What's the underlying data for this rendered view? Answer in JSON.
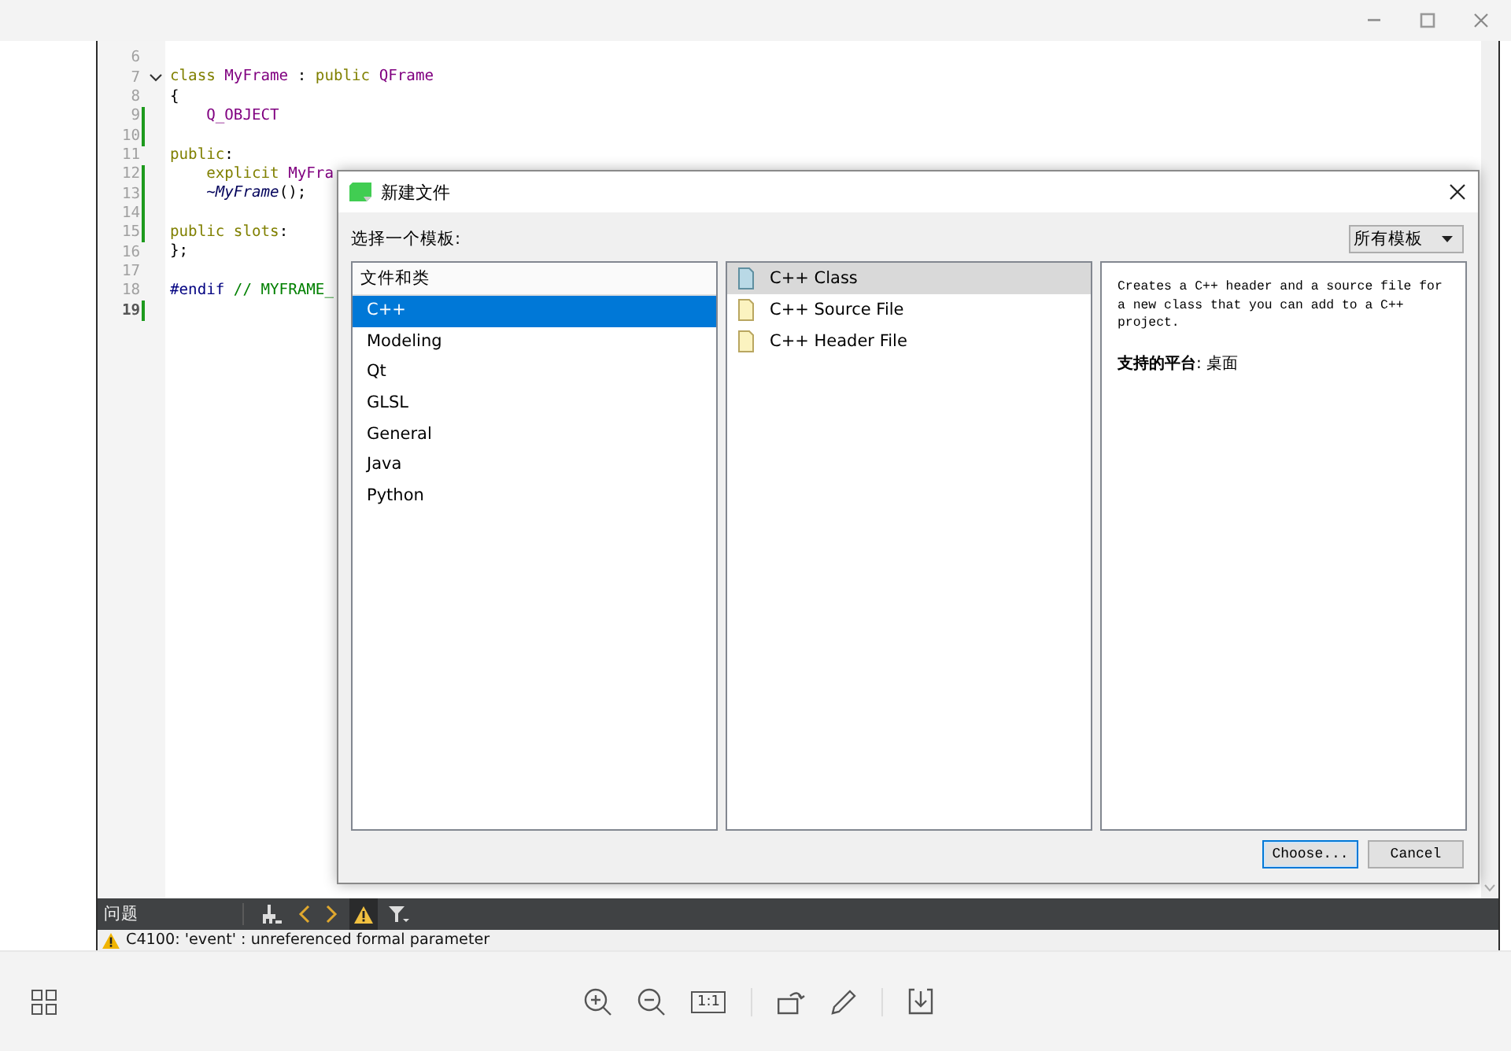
{
  "editor": {
    "lines": [
      {
        "number": "6",
        "changed": false,
        "current": false,
        "fold": false
      },
      {
        "number": "7",
        "changed": false,
        "current": false,
        "fold": true,
        "tokens": [
          {
            "kind": "keyword",
            "text": "class "
          },
          {
            "kind": "type",
            "text": "MyFrame"
          },
          {
            "kind": "plain",
            "text": " : "
          },
          {
            "kind": "keyword",
            "text": "public "
          },
          {
            "kind": "type",
            "text": "QFrame"
          }
        ]
      },
      {
        "number": "8",
        "changed": false,
        "current": false,
        "fold": false,
        "tokens": [
          {
            "kind": "plain",
            "text": "{"
          }
        ]
      },
      {
        "number": "9",
        "changed": true,
        "current": false,
        "fold": false,
        "tokens": [
          {
            "kind": "type",
            "text": "    Q_OBJECT"
          }
        ]
      },
      {
        "number": "10",
        "changed": true,
        "current": false,
        "fold": false
      },
      {
        "number": "11",
        "changed": false,
        "current": false,
        "fold": false,
        "tokens": [
          {
            "kind": "keyword",
            "text": "public"
          },
          {
            "kind": "plain",
            "text": ":"
          }
        ]
      },
      {
        "number": "12",
        "changed": true,
        "current": false,
        "fold": false,
        "tokens": [
          {
            "kind": "keyword",
            "text": "    explicit "
          },
          {
            "kind": "type",
            "text": "MyFra"
          }
        ]
      },
      {
        "number": "13",
        "changed": true,
        "current": false,
        "fold": false,
        "tokens": [
          {
            "kind": "function",
            "text": "    ~MyFrame"
          },
          {
            "kind": "plain",
            "text": "();"
          }
        ]
      },
      {
        "number": "14",
        "changed": true,
        "current": false,
        "fold": false
      },
      {
        "number": "15",
        "changed": true,
        "current": false,
        "fold": false,
        "tokens": [
          {
            "kind": "keyword",
            "text": "public slots"
          },
          {
            "kind": "plain",
            "text": ":"
          }
        ]
      },
      {
        "number": "16",
        "changed": false,
        "current": false,
        "fold": false,
        "tokens": [
          {
            "kind": "plain",
            "text": "};"
          }
        ]
      },
      {
        "number": "17",
        "changed": false,
        "current": false,
        "fold": false
      },
      {
        "number": "18",
        "changed": false,
        "current": false,
        "fold": false,
        "tokens": [
          {
            "kind": "preprocessor",
            "text": "#endif"
          },
          {
            "kind": "comment",
            "text": " // MYFRAME_"
          }
        ]
      },
      {
        "number": "19",
        "changed": true,
        "current": true,
        "fold": false
      }
    ]
  },
  "issues_panel": {
    "title": "问题",
    "warning_filter_on": true,
    "message": "C4100: 'event' : unreferenced formal parameter"
  },
  "dialog": {
    "title": "新建文件",
    "prompt": "选择一个模板:",
    "filter": "所有模板",
    "categories_header": "文件和类",
    "categories": [
      {
        "label": "C++",
        "selected": true
      },
      {
        "label": "Modeling",
        "selected": false
      },
      {
        "label": "Qt",
        "selected": false
      },
      {
        "label": "GLSL",
        "selected": false
      },
      {
        "label": "General",
        "selected": false
      },
      {
        "label": "Java",
        "selected": false
      },
      {
        "label": "Python",
        "selected": false
      }
    ],
    "templates": [
      {
        "label": "C++ Class",
        "selected": true,
        "kind": "class"
      },
      {
        "label": "C++ Source File",
        "selected": false,
        "kind": "file"
      },
      {
        "label": "C++ Header File",
        "selected": false,
        "kind": "file"
      }
    ],
    "description": "Creates a C++ header and a source file for a new class that you can add to a C++ project.",
    "platforms": "**支持的平台**: 桌面",
    "buttons": [
      {
        "label": "Choose...",
        "default": true
      },
      {
        "label": "Cancel",
        "default": false
      }
    ]
  },
  "viewer_toolbar": {
    "actual_size": "1:1"
  }
}
